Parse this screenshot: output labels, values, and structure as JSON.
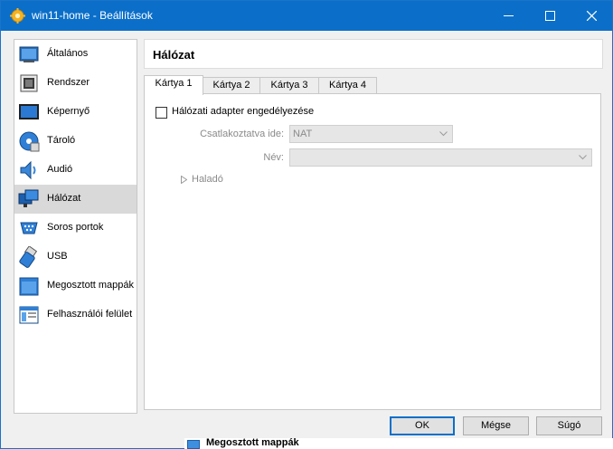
{
  "window": {
    "title": "win11-home - Beállítások",
    "accent_color": "#0b6fc9",
    "controls": [
      "minimize-icon",
      "maximize-icon",
      "close-icon"
    ]
  },
  "sidebar": {
    "selected_index": 5,
    "items": [
      {
        "label": "Általános",
        "icon": "general-icon"
      },
      {
        "label": "Rendszer",
        "icon": "system-icon"
      },
      {
        "label": "Képernyő",
        "icon": "display-icon"
      },
      {
        "label": "Tároló",
        "icon": "storage-icon"
      },
      {
        "label": "Audió",
        "icon": "audio-icon"
      },
      {
        "label": "Hálózat",
        "icon": "network-icon"
      },
      {
        "label": "Soros portok",
        "icon": "serial-ports-icon"
      },
      {
        "label": "USB",
        "icon": "usb-icon"
      },
      {
        "label": "Megosztott mappák",
        "icon": "shared-folders-icon"
      },
      {
        "label": "Felhasználói felület",
        "icon": "user-interface-icon"
      }
    ]
  },
  "main": {
    "title": "Hálózat",
    "tabs": [
      {
        "label": "Kártya 1",
        "active": true
      },
      {
        "label": "Kártya 2",
        "active": false
      },
      {
        "label": "Kártya 3",
        "active": false
      },
      {
        "label": "Kártya 4",
        "active": false
      }
    ],
    "enable_adapter": {
      "label": "Hálózati adapter engedélyezése",
      "checked": false
    },
    "attached_to": {
      "label": "Csatlakoztatva ide:",
      "value": "NAT",
      "enabled": false
    },
    "name": {
      "label": "Név:",
      "value": "",
      "enabled": false
    },
    "advanced": {
      "label": "Haladó",
      "expanded": false
    }
  },
  "footer": {
    "ok_label": "OK",
    "cancel_label": "Mégse",
    "help_label": "Súgó"
  },
  "background_window": {
    "text": "Megosztott mappák"
  }
}
